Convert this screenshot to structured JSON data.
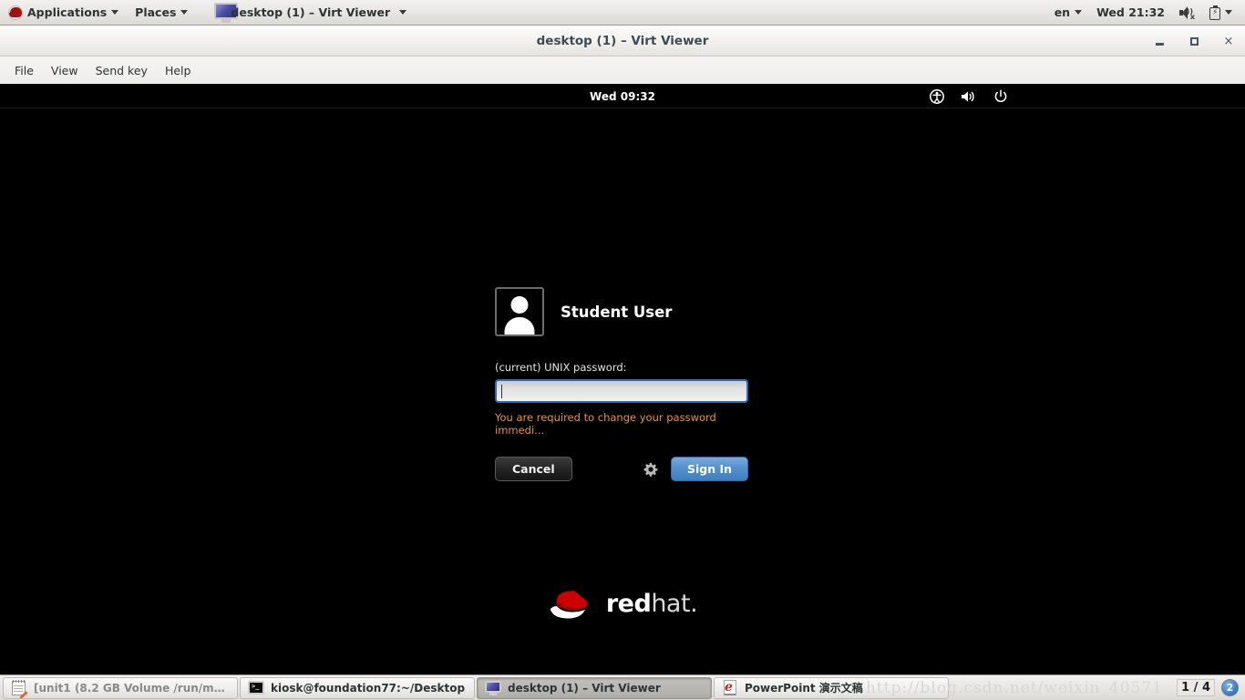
{
  "top_panel": {
    "logo_icon": "redhat-logo-icon",
    "applications_label": "Applications",
    "places_label": "Places",
    "window_task_label": "desktop (1) – Virt Viewer",
    "window_task_icon": "monitor-icon",
    "keyboard_layout": "en",
    "clock": "Wed 21:32",
    "volume_icon": "speaker-muted-icon",
    "battery_icon": "battery-charging-icon"
  },
  "virt_viewer": {
    "title": "desktop (1) – Virt Viewer",
    "menu": [
      {
        "label": "File"
      },
      {
        "label": "View"
      },
      {
        "label": "Send key"
      },
      {
        "label": "Help"
      }
    ],
    "controls": {
      "minimize": "minimize-icon",
      "maximize": "maximize-icon",
      "close": "×"
    }
  },
  "gdm": {
    "clock": "Wed 09:32",
    "icons": {
      "accessibility": "accessibility-icon",
      "volume": "volume-icon",
      "power": "power-icon"
    },
    "user_name": "Student User",
    "avatar_icon": "user-avatar-icon",
    "password_label": "(current) UNIX password:",
    "password_value": "",
    "password_placeholder": "",
    "warning_text": "You are required to change your password immedi...",
    "cancel_label": "Cancel",
    "signin_label": "Sign In",
    "gear_icon": "gear-icon",
    "brand": {
      "bold": "red",
      "light": "hat.",
      "hat_icon": "redhat-fedora-icon"
    },
    "colors": {
      "warning": "#e8932c",
      "focus_border": "#2f6bb3",
      "signin_blue": "#5491cd",
      "brand_red": "#cc0000"
    }
  },
  "taskbar": {
    "items": [
      {
        "label": "[unit1 (8.2 GB Volume /run/media...",
        "icon": "notepad-icon",
        "active": false
      },
      {
        "label": "kiosk@foundation77:~/Desktop",
        "icon": "terminal-icon",
        "active": false
      },
      {
        "label": "desktop (1) – Virt Viewer",
        "icon": "monitor-icon",
        "active": true
      },
      {
        "label": "PowerPoint 演示文稿",
        "icon": "presentation-icon",
        "active": false
      }
    ],
    "watermark": "http://blog.csdn.net/weixin_40571",
    "pager": "1 / 4",
    "notification_count": "2"
  }
}
